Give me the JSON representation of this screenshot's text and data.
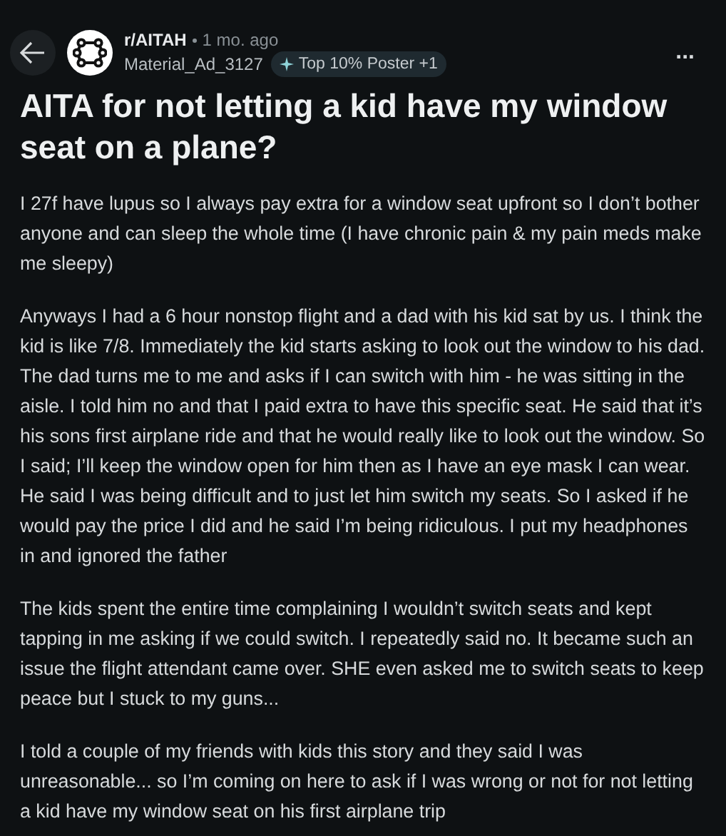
{
  "post": {
    "subreddit": "r/AITAH",
    "age": "1 mo. ago",
    "author": "Material_Ad_3127",
    "badge": "Top 10% Poster +1",
    "more": "...",
    "title": "AITA for not letting a kid have my window seat on a plane?",
    "paragraphs": [
      "I 27f have lupus so I always pay extra for a window seat upfront so I don’t bother anyone and can sleep the whole time (I have chronic pain & my pain meds make me sleepy)",
      "Anyways I had a 6 hour nonstop flight and a dad with his kid sat by us. I think the kid is like 7/8. Immediately the kid starts asking to look out the window to his dad. The dad turns me to me and asks if I can switch with him - he was sitting in the aisle. I told him no and that I paid extra to have this specific seat. He said that it’s his sons first airplane ride and that he would really like to look out the window. So I said; I’ll keep the window open for him then as I have an eye mask I can wear. He said I was being difficult and to just let him switch my seats. So I asked if he would pay the price I did and he said I’m being ridiculous. I put my headphones in and ignored the father",
      "The kids spent the entire time complaining I wouldn’t switch seats and kept tapping in me asking if we could switch. I repeatedly said no. It became such an issue the flight attendant came over. SHE even asked me to switch seats to keep peace but I stuck to my guns...",
      "I told a couple of my friends with kids this story and they said I was unreasonable... so I’m coming on here to ask if I was wrong or not for not letting a kid have my window seat on his first airplane trip"
    ]
  }
}
